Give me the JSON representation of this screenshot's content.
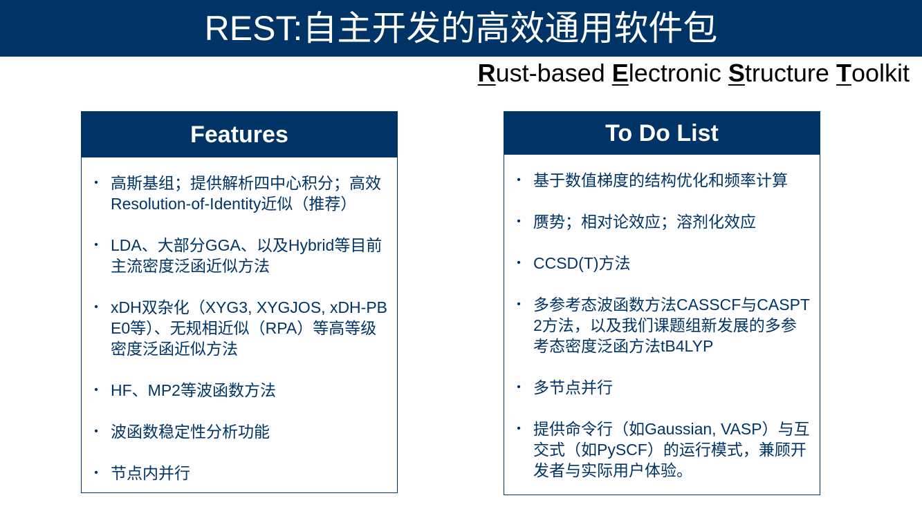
{
  "header": {
    "title": "REST:自主开发的高效通用软件包"
  },
  "subtitle": {
    "parts": [
      {
        "initial": "R",
        "rest": "ust-based"
      },
      {
        "initial": "E",
        "rest": "lectronic"
      },
      {
        "initial": "S",
        "rest": "tructure"
      },
      {
        "initial": "T",
        "rest": "oolkit"
      }
    ]
  },
  "features": {
    "title": "Features",
    "items": [
      "高斯基组；提供解析四中心积分；高效Resolution-of-Identity近似（推荐）",
      "LDA、大部分GGA、以及Hybrid等目前主流密度泛函近似方法",
      "xDH双杂化（XYG3, XYGJOS, xDH-PBE0等）、无规相近似（RPA）等高等级密度泛函近似方法",
      "HF、MP2等波函数方法",
      "波函数稳定性分析功能",
      "节点内并行"
    ]
  },
  "todo": {
    "title": "To Do List",
    "items": [
      "基于数值梯度的结构优化和频率计算",
      "赝势；相对论效应；溶剂化效应",
      "CCSD(T)方法",
      "多参考态波函数方法CASSCF与CASPT2方法，以及我们课题组新发展的多参考态密度泛函方法tB4LYP",
      "多节点并行",
      "提供命令行（如Gaussian, VASP）与互交式（如PySCF）的运行模式，兼顾开发者与实际用户体验。"
    ]
  },
  "bullet_glyph": "•",
  "colors": {
    "brand": "#003366",
    "background": "#ffffff"
  }
}
